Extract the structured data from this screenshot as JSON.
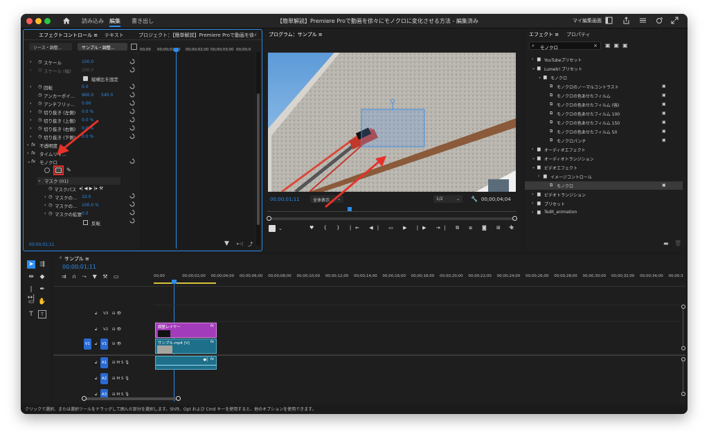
{
  "titlebar": {
    "workspaces": [
      "読み込み",
      "編集",
      "書き出し"
    ],
    "active_workspace": "編集",
    "document_title": "【簡単解説】Premiere Proで動画を徐々にモノクロに変化させる方法 - 編集済み",
    "my_workspace": "マイ編集画面"
  },
  "effect_controls": {
    "tabs": [
      "エフェクトコントロール ≡",
      "テキスト",
      "プロジェクト：【簡単解説】Premiere Proで動画を徐々にモ"
    ],
    "source_dropdown": "ソース・調整...",
    "clip_dropdown": "サンプル・調整...",
    "ruler_ticks": [
      "00;00",
      "00;00;01;00",
      "00;00;02;00",
      "00;00;03;00",
      "00;00;0"
    ],
    "properties": [
      {
        "label": "スケール",
        "value": "100.0"
      },
      {
        "label": "スケール (幅)",
        "value": "100.0"
      },
      {
        "label": "縦横比を固定",
        "value": ""
      },
      {
        "label": "回転",
        "value": "0.0"
      },
      {
        "label": "アンカーポイ...",
        "value": "960.0",
        "value2": "540.0"
      },
      {
        "label": "アンチフリッ...",
        "value": "0.00"
      },
      {
        "label": "切り抜き (左側)",
        "value": "0.0 %"
      },
      {
        "label": "切り抜き (上側)",
        "value": "0.0 %"
      },
      {
        "label": "切り抜き (右側)",
        "value": "0.0 %"
      },
      {
        "label": "切り抜き (下側)",
        "value": "0.0 %"
      },
      {
        "label": "不透明度",
        "value": ""
      },
      {
        "label": "タイムリマ...",
        "value": ""
      },
      {
        "label": "モノクロ",
        "value": ""
      }
    ],
    "mask_label": "マスク (01)",
    "mask_path_label": "マスクパス",
    "mask_props": [
      {
        "label": "マスクの...",
        "value": "10.0"
      },
      {
        "label": "マスクの...",
        "value": "100.0 %"
      },
      {
        "label": "マスクの拡張",
        "value": "0.0"
      }
    ],
    "invert_label": "反転",
    "timecode": "00;00;01;11"
  },
  "program_monitor": {
    "title": "プログラム：サンプル ≡",
    "timecode": "00;00;01;11",
    "fit": "全体表示",
    "resolution": "1/2",
    "duration": "00;00;04;04"
  },
  "effects_panel": {
    "tabs": [
      "エフェクト ≡",
      "プロパティ"
    ],
    "search_value": "モノクロ",
    "tree": [
      {
        "label": "YouTubeプリセット",
        "level": 0,
        "type": "folder"
      },
      {
        "label": "Lumetri プリセット",
        "level": 0,
        "type": "folder"
      },
      {
        "label": "モノクロ",
        "level": 1,
        "type": "folder"
      },
      {
        "label": "モノクロのノーマルコントラスト",
        "level": 2,
        "type": "preset"
      },
      {
        "label": "モノクロの色あせたフィルム",
        "level": 2,
        "type": "preset"
      },
      {
        "label": "モノクロの色あせたフィルム (強)",
        "level": 2,
        "type": "preset"
      },
      {
        "label": "モノクロの色あせたフィルム 100",
        "level": 2,
        "type": "preset"
      },
      {
        "label": "モノクロの色あせたフィルム 150",
        "level": 2,
        "type": "preset"
      },
      {
        "label": "モノクロの色あせたフィルム 50",
        "level": 2,
        "type": "preset"
      },
      {
        "label": "モノクロパンチ",
        "level": 2,
        "type": "preset"
      },
      {
        "label": "オーディオエフェクト",
        "level": 0,
        "type": "folder"
      },
      {
        "label": "オーディオトランジション",
        "level": 0,
        "type": "folder"
      },
      {
        "label": "ビデオエフェクト",
        "level": 0,
        "type": "folder"
      },
      {
        "label": "イメージコントロール",
        "level": 1,
        "type": "folder"
      },
      {
        "label": "モノクロ",
        "level": 2,
        "type": "preset",
        "selected": true
      },
      {
        "label": "ビデオトランジション",
        "level": 0,
        "type": "folder"
      },
      {
        "label": "プリセット",
        "level": 0,
        "type": "folder"
      },
      {
        "label": "Tedit_animation",
        "level": 0,
        "type": "folder"
      }
    ]
  },
  "timeline": {
    "tab": "サンプル ≡",
    "timecode": "00;00;01;11",
    "ruler": [
      "00;00",
      "00;00;02;00",
      "00;00;04;00",
      "00;00;06;00",
      "00;00;08;00",
      "00;00;10;00",
      "00;00;12;00",
      "00;00;14;00",
      "00;00;16;00",
      "00;00;18;00",
      "00;00;20;00",
      "00;00;22;00",
      "00;00;24;00",
      "00;00;26;00",
      "00;00;28;00",
      "00;00;30;00",
      "00;00;32;00",
      "00;00;34;00",
      "00;00;3"
    ],
    "tracks": [
      "V3",
      "V2",
      "V1",
      "A1",
      "A2",
      "A3"
    ],
    "v1_source": "V1",
    "clip_adjust": "調整レイヤー",
    "clip_video": "サンプル.mp4 [V]",
    "fx": "fx"
  },
  "status_text": "クリックで選択、または選択ツールをドラッグして囲んだ部分を選択します。Shift、Opt および Cmd キーを使用すると、他のオプションを使用できます。",
  "colors": {
    "accent": "#2d8ceb",
    "annotation": "#e6322b",
    "adjust_clip": "#a33cba",
    "video_clip": "#1d6f8a"
  }
}
